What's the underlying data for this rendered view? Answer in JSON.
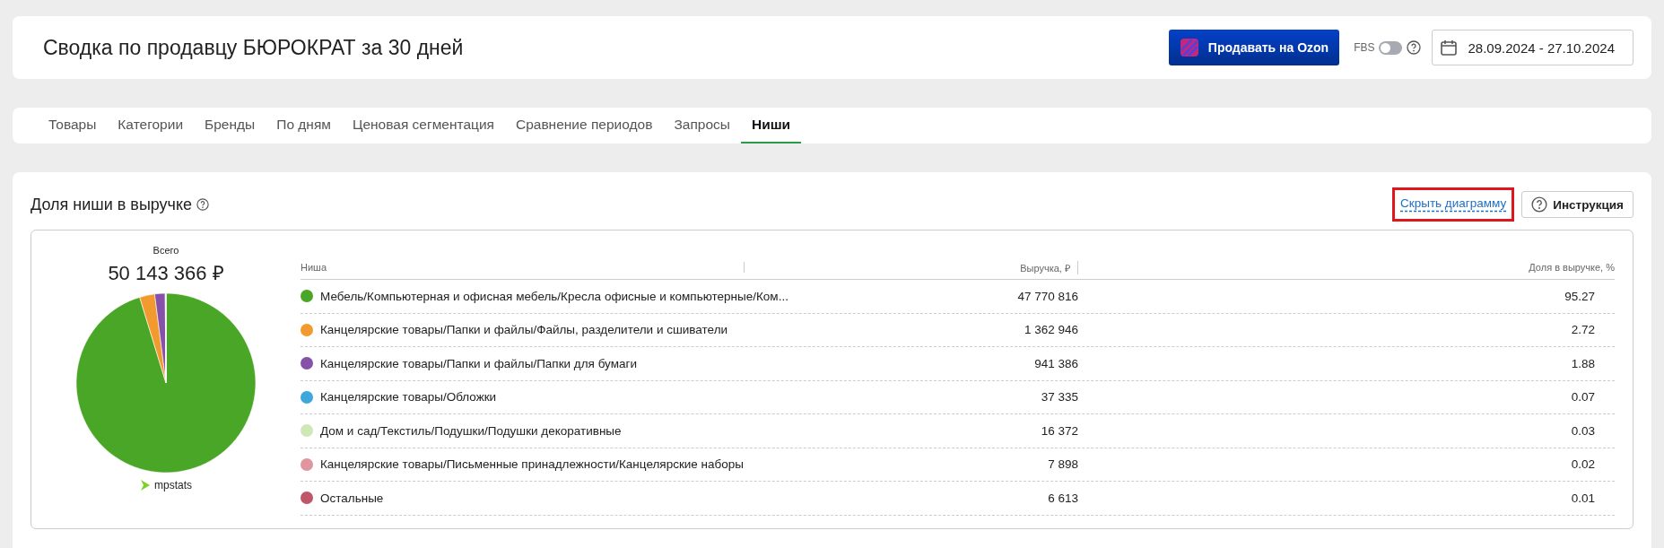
{
  "header": {
    "title": "Сводка по продавцу БЮРОКРАТ за 30 дней",
    "sell_button": "Продавать на Ozon",
    "fbs_toggle": {
      "label": "FBS",
      "on": false
    },
    "date_range": "28.09.2024 - 27.10.2024"
  },
  "tabs": [
    {
      "label": "Товары",
      "selected": false
    },
    {
      "label": "Категории",
      "selected": false
    },
    {
      "label": "Бренды",
      "selected": false
    },
    {
      "label": "По дням",
      "selected": false
    },
    {
      "label": "Ценовая сегментация",
      "selected": false
    },
    {
      "label": "Сравнение периодов",
      "selected": false
    },
    {
      "label": "Запросы",
      "selected": false
    },
    {
      "label": "Ниши",
      "selected": true
    }
  ],
  "section": {
    "title": "Доля ниши в выручке",
    "hide_chart_link": {
      "label": "Скрыть диаграмму",
      "highlighted": true
    },
    "instruction_button": "Инструкция"
  },
  "summary": {
    "label": "Всего",
    "total": "50 143 366 ₽",
    "brand": "mpstats"
  },
  "table": {
    "columns": [
      "Ниша",
      "Выручка, ₽",
      "Доля в выручке, %"
    ],
    "rows": [
      {
        "niche": "Мебель/Компьютерная и офисная мебель/Кресла офисные и компьютерные/Ком...",
        "revenue": "47 770 816",
        "share": "95.27",
        "color": "#4aa626"
      },
      {
        "niche": "Канцелярские товары/Папки и файлы/Файлы, разделители и сшиватели",
        "revenue": "1 362 946",
        "share": "2.72",
        "color": "#f39a2e"
      },
      {
        "niche": "Канцелярские товары/Папки и файлы/Папки для бумаги",
        "revenue": "941 386",
        "share": "1.88",
        "color": "#8552a8"
      },
      {
        "niche": "Канцелярские товары/Обложки",
        "revenue": "37 335",
        "share": "0.07",
        "color": "#3ea7dc"
      },
      {
        "niche": "Дом и сад/Текстиль/Подушки/Подушки декоративные",
        "revenue": "16 372",
        "share": "0.03",
        "color": "#cfe8b8"
      },
      {
        "niche": "Канцелярские товары/Письменные принадлежности/Канцелярские наборы",
        "revenue": "7 898",
        "share": "0.02",
        "color": "#e0959f"
      },
      {
        "niche": "Остальные",
        "revenue": "6 613",
        "share": "0.01",
        "color": "#c0566a"
      }
    ]
  }
}
